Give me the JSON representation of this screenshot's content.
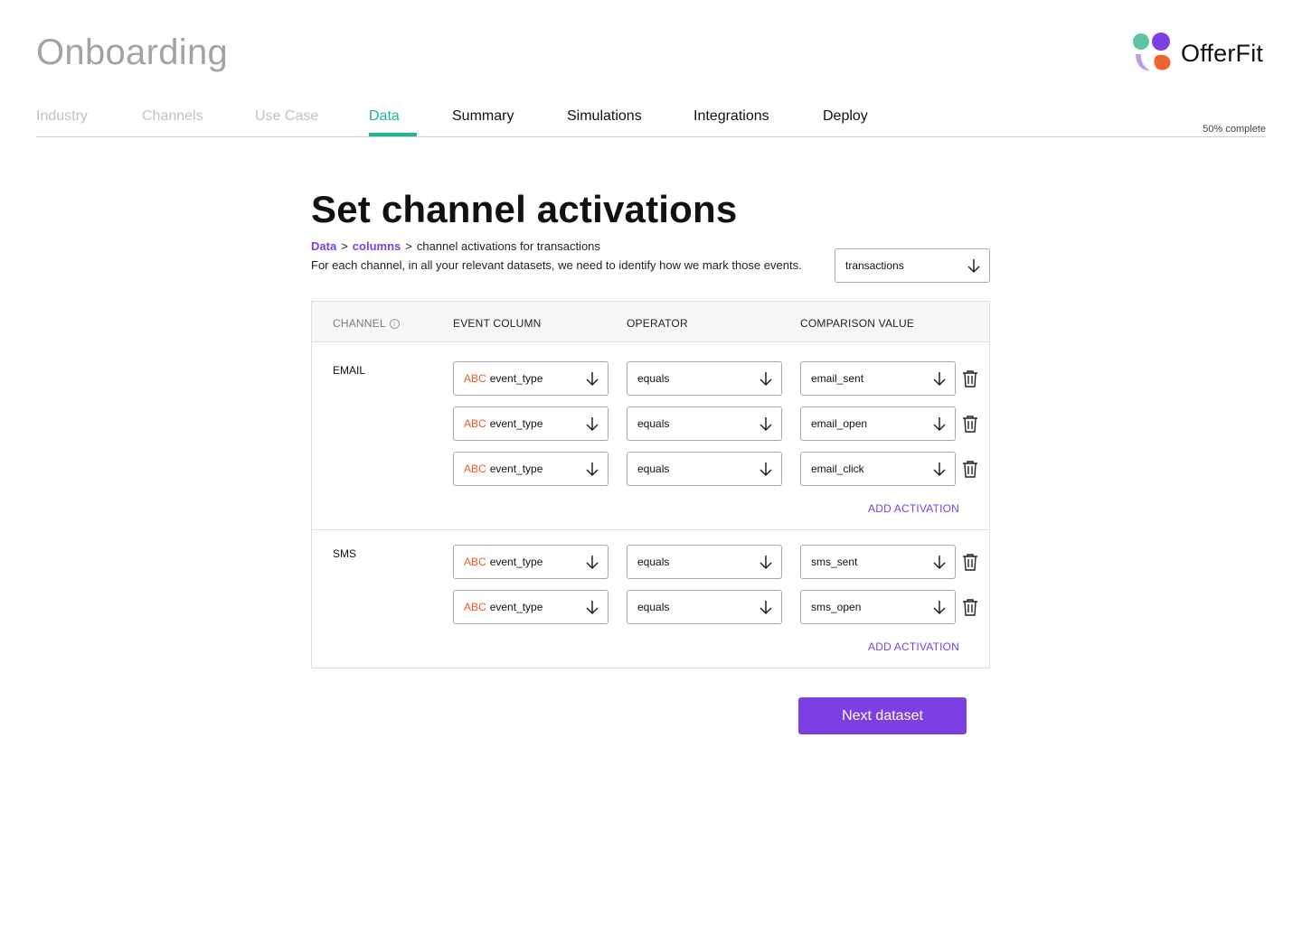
{
  "header": {
    "title": "Onboarding",
    "logo_text": "OfferFit",
    "progress_text": "50% complete"
  },
  "tabs": [
    {
      "label": "Industry",
      "state": "done"
    },
    {
      "label": "Channels",
      "state": "done"
    },
    {
      "label": "Use Case",
      "state": "done"
    },
    {
      "label": "Data",
      "state": "active"
    },
    {
      "label": "Summary",
      "state": "todo"
    },
    {
      "label": "Simulations",
      "state": "todo"
    },
    {
      "label": "Integrations",
      "state": "todo"
    },
    {
      "label": "Deploy",
      "state": "todo"
    }
  ],
  "main": {
    "heading": "Set channel activations",
    "breadcrumb": {
      "links": [
        "Data",
        "columns"
      ],
      "current": "channel activations for transactions",
      "separator": ">"
    },
    "description": "For each channel, in all your relevant datasets, we need to identify how we mark those events.",
    "dataset_select": "transactions"
  },
  "table": {
    "headers": {
      "channel": "CHANNEL",
      "event_column": "EVENT COLUMN",
      "operator": "OPERATOR",
      "comparison_value": "COMPARISON VALUE"
    },
    "type_tag": "ABC",
    "add_activation_label": "ADD ACTIVATION",
    "channels": [
      {
        "name": "EMAIL",
        "rows": [
          {
            "event_column": "event_type",
            "operator": "equals",
            "value": "email_sent"
          },
          {
            "event_column": "event_type",
            "operator": "equals",
            "value": "email_open"
          },
          {
            "event_column": "event_type",
            "operator": "equals",
            "value": "email_click"
          }
        ]
      },
      {
        "name": "SMS",
        "rows": [
          {
            "event_column": "event_type",
            "operator": "equals",
            "value": "sms_sent"
          },
          {
            "event_column": "event_type",
            "operator": "equals",
            "value": "sms_open"
          }
        ]
      }
    ]
  },
  "actions": {
    "next_label": "Next dataset"
  },
  "colors": {
    "accent_purple": "#7b3fe4",
    "active_tab_teal": "#1fb59a",
    "type_tag_orange": "#ea5b2b"
  }
}
